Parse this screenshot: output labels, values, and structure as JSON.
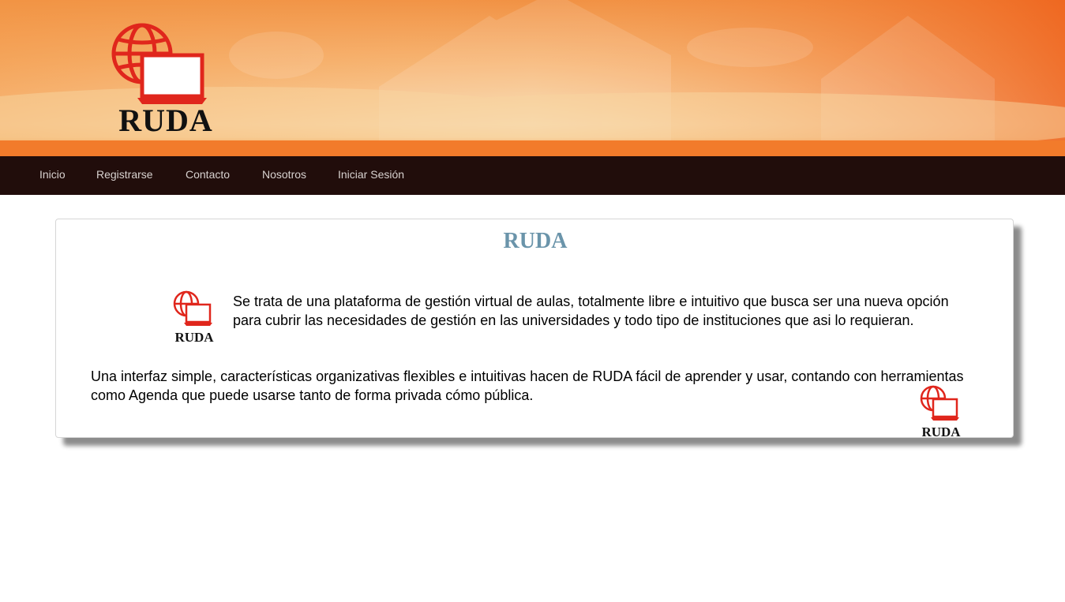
{
  "brand": {
    "logo_text": "RUDA",
    "colors": {
      "logo_red": "#e0261c",
      "nav_bg": "#210d0b",
      "title_blue": "#6a94aa",
      "banner_orange": "#f08a3a"
    }
  },
  "nav": {
    "items": [
      {
        "label": "Inicio"
      },
      {
        "label": "Registrarse"
      },
      {
        "label": "Contacto"
      },
      {
        "label": "Nosotros"
      },
      {
        "label": "Iniciar Sesión"
      }
    ]
  },
  "main": {
    "title": "RUDA",
    "paragraph_1": "Se trata de una plataforma de gestión virtual de aulas, totalmente libre e intuitivo que busca ser una nueva opción para cubrir las necesidades de gestión en las universidades y todo tipo de instituciones que asi lo requieran.",
    "paragraph_2": "Una interfaz simple, características organizativas flexibles e intuitivas hacen de RUDA fácil de aprender y usar, contando con herramientas como Agenda que puede usarse tanto de forma privada cómo pública."
  }
}
